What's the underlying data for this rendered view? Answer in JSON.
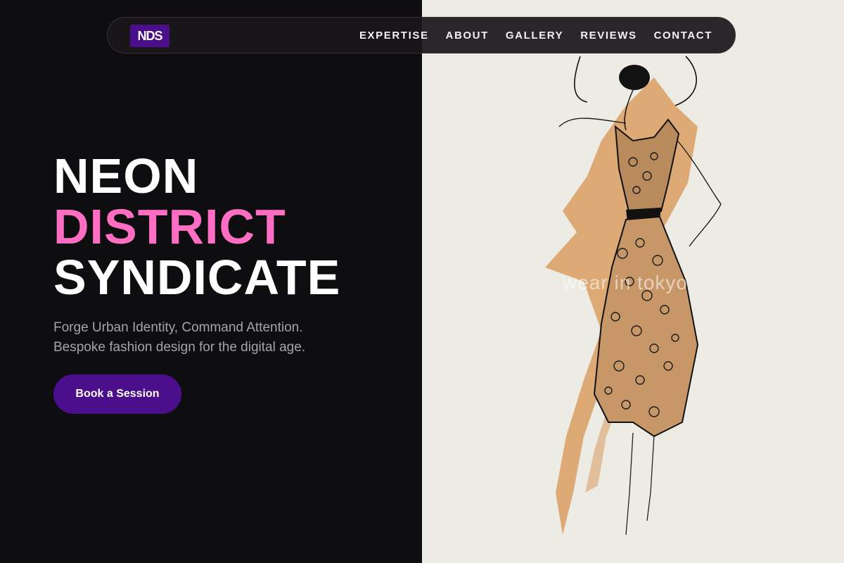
{
  "nav": {
    "logo": "NDS",
    "links": [
      "EXPERTISE",
      "ABOUT",
      "GALLERY",
      "REVIEWS",
      "CONTACT"
    ]
  },
  "hero": {
    "title_line1": "NEON",
    "title_line2": "DISTRICT",
    "title_line3": "SYNDICATE",
    "tagline_line1": "Forge Urban Identity, Command Attention.",
    "tagline_line2": "Bespoke fashion design for the digital age.",
    "cta_label": "Book a Session"
  },
  "image": {
    "subject": "fashion-sketch-dress-illustration",
    "watermark": "wear in tokyo"
  },
  "colors": {
    "background": "#0e0d0f",
    "accent_pink": "#ff6ec2",
    "brand_purple": "#4b0f8c",
    "paper": "#ecebe4"
  }
}
